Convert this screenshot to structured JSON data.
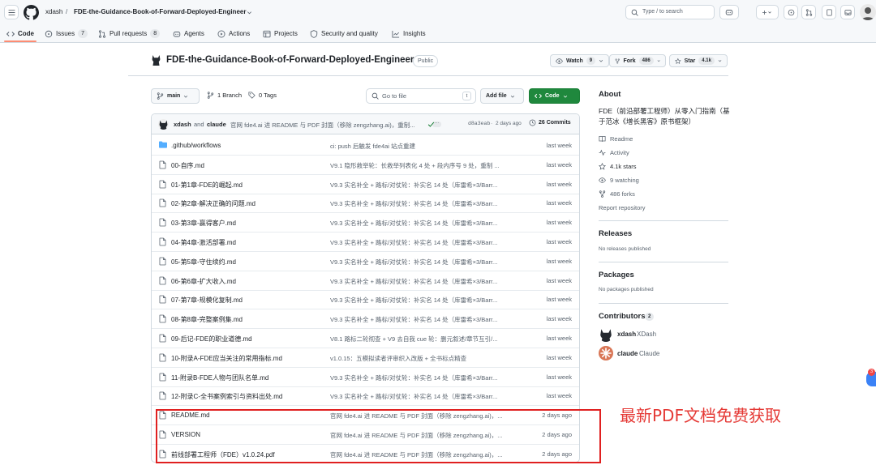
{
  "header": {
    "owner": "xdash",
    "repo": "FDE-the-Guidance-Book-of-Forward-Deployed-Engineer",
    "search_placeholder": "Type / to search"
  },
  "nav": {
    "code": "Code",
    "issues": "Issues",
    "issues_count": "7",
    "pull_requests": "Pull requests",
    "pull_requests_count": "8",
    "agents": "Agents",
    "actions": "Actions",
    "projects": "Projects",
    "security": "Security and quality",
    "insights": "Insights"
  },
  "repo": {
    "title": "FDE-the-Guidance-Book-of-Forward-Deployed-Engineer",
    "visibility": "Public",
    "watch_label": "Watch",
    "watch_count": "9",
    "fork_label": "Fork",
    "fork_count": "486",
    "star_label": "Star",
    "star_count": "4.1k"
  },
  "toolbar": {
    "branch": "main",
    "branches": "1 Branch",
    "tags": "0 Tags",
    "goto_placeholder": "Go to file",
    "goto_key": "t",
    "add_file": "Add file",
    "code_button": "Code"
  },
  "commit": {
    "authors_main": "xdash",
    "and": "and",
    "authors_second": "claude",
    "message": "官网 fde4.ai 进 README 与 PDF 封面（移除 zengzhang.ai)，重制...",
    "hash": "d8a3eab",
    "dot": "·",
    "when": "2 days ago",
    "commits": "26 Commits"
  },
  "files": [
    {
      "name": ".github/workflows",
      "type": "folder",
      "message": "ci: push 后触发 fde4ai 站点重建",
      "time": "last week"
    },
    {
      "name": "00-自序.md",
      "type": "file",
      "message": "V9.1 隐形救举轮：长救举列表化 4 处 + 段内序号 9 处，重制 ...",
      "time": "last week"
    },
    {
      "name": "01-第1章-FDE的崛起.md",
      "type": "file",
      "message": "V9.3 实名补全 + 路标/对仗轮：补实名 14 处（库雷希×3/Barr...",
      "time": "last week"
    },
    {
      "name": "02-第2章-解决正确的问题.md",
      "type": "file",
      "message": "V9.3 实名补全 + 路标/对仗轮：补实名 14 处（库雷希×3/Barr...",
      "time": "last week"
    },
    {
      "name": "03-第3章-赢得客户.md",
      "type": "file",
      "message": "V9.3 实名补全 + 路标/对仗轮：补实名 14 处（库雷希×3/Barr...",
      "time": "last week"
    },
    {
      "name": "04-第4章-激活部署.md",
      "type": "file",
      "message": "V9.3 实名补全 + 路标/对仗轮：补实名 14 处（库雷希×3/Barr...",
      "time": "last week"
    },
    {
      "name": "05-第5章-守住续约.md",
      "type": "file",
      "message": "V9.3 实名补全 + 路标/对仗轮：补实名 14 处（库雷希×3/Barr...",
      "time": "last week"
    },
    {
      "name": "06-第6章-扩大收入.md",
      "type": "file",
      "message": "V9.3 实名补全 + 路标/对仗轮：补实名 14 处（库雷希×3/Barr...",
      "time": "last week"
    },
    {
      "name": "07-第7章-规模化复制.md",
      "type": "file",
      "message": "V9.3 实名补全 + 路标/对仗轮：补实名 14 处（库雷希×3/Barr...",
      "time": "last week"
    },
    {
      "name": "08-第8章-完整案例集.md",
      "type": "file",
      "message": "V9.3 实名补全 + 路标/对仗轮：补实名 14 处（库雷希×3/Barr...",
      "time": "last week"
    },
    {
      "name": "09-后记-FDE的职业道德.md",
      "type": "file",
      "message": "V8.1 路标二轮彻查 + V9 去自我 cue 轮：删元叙述/章节互引/...",
      "time": "last week"
    },
    {
      "name": "10-附录A-FDE应当关注的常用指标.md",
      "type": "file",
      "message": "v1.0.15：五模拟读者评审织入改版 + 全书标点精查",
      "time": "last week"
    },
    {
      "name": "11-附录B-FDE人物与团队名单.md",
      "type": "file",
      "message": "V9.3 实名补全 + 路标/对仗轮：补实名 14 处（库雷希×3/Barr...",
      "time": "last week"
    },
    {
      "name": "12-附录C-全书案例索引与资料出处.md",
      "type": "file",
      "message": "V9.3 实名补全 + 路标/对仗轮：补实名 14 处（库雷希×3/Barr...",
      "time": "last week"
    },
    {
      "name": "README.md",
      "type": "file",
      "message": "官网 fde4.ai 进 README 与 PDF 封面（移除 zengzhang.ai)，...",
      "time": "2 days ago"
    },
    {
      "name": "VERSION",
      "type": "file",
      "message": "官网 fde4.ai 进 README 与 PDF 封面（移除 zengzhang.ai)，...",
      "time": "2 days ago"
    },
    {
      "name": "前线部署工程师（FDE）v1.0.24.pdf",
      "type": "file",
      "message": "官网 fde4.ai 进 README 与 PDF 封面（移除 zengzhang.ai)，...",
      "time": "2 days ago"
    }
  ],
  "sidebar": {
    "about_title": "About",
    "description": "FDE（前沿部署工程师）从零入门指南（基于范冰《增长黑客》原书框架）",
    "readme": "Readme",
    "activity": "Activity",
    "stars": "4.1k stars",
    "watching": "9 watching",
    "forks": "486 forks",
    "report": "Report repository",
    "releases_title": "Releases",
    "releases_none": "No releases published",
    "packages_title": "Packages",
    "packages_none": "No packages published",
    "contributors_title": "Contributors",
    "contributors_count": "2",
    "contributors": [
      {
        "login": "xdash",
        "name": "XDash"
      },
      {
        "login": "claude",
        "name": "Claude"
      }
    ]
  },
  "overlay": {
    "promo_text": "最新PDF文档免费获取",
    "badge_count": "3"
  },
  "colors": {
    "accent_green": "#1f883d",
    "link_blue": "#0969da",
    "folder_blue": "#54aeff",
    "annotation_red": "#e02020"
  }
}
